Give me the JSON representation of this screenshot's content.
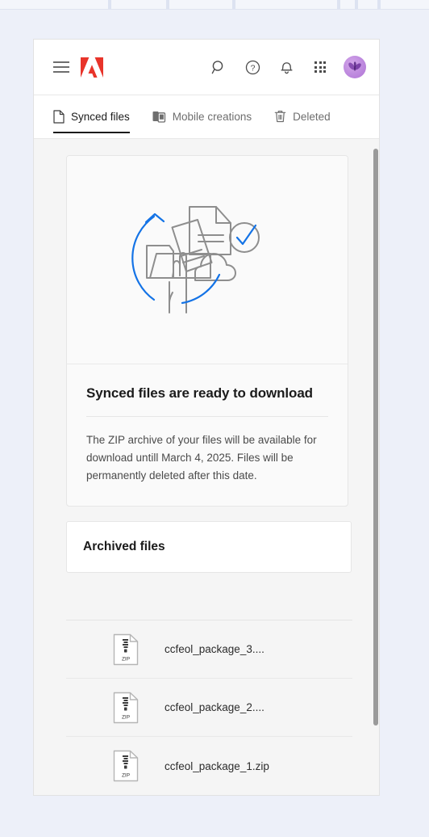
{
  "window": {
    "title": "Adobe Creative Cloud Files"
  },
  "header": {
    "menu_label": "Menu",
    "logo_label": "Adobe",
    "logo_color": "#E8342A",
    "icons": [
      {
        "name": "search-icon",
        "label": "Search"
      },
      {
        "name": "help-icon",
        "label": "Help"
      },
      {
        "name": "notifications-icon",
        "label": "Notifications"
      },
      {
        "name": "app-grid-icon",
        "label": "Apps"
      }
    ],
    "avatar_label": "Account"
  },
  "tabs": [
    {
      "id": "synced-files",
      "label": "Synced files",
      "icon": "document-icon",
      "active": true
    },
    {
      "id": "mobile-creations",
      "label": "Mobile creations",
      "icon": "mobile-device-icon",
      "active": false
    },
    {
      "id": "deleted",
      "label": "Deleted",
      "icon": "trash-icon",
      "active": false
    }
  ],
  "hero": {
    "illustration_name": "sync-to-cloud-illustration",
    "title": "Synced files are ready to download",
    "description": "The ZIP archive of your files will be available for download untill March 4, 2025. Files will be permanently deleted after this date."
  },
  "archived": {
    "title": "Archived files"
  },
  "files": [
    {
      "name": "ccfeol_package_3....",
      "type": "ZIP"
    },
    {
      "name": "ccfeol_package_2....",
      "type": "ZIP"
    },
    {
      "name": "ccfeol_package_1.zip",
      "type": "ZIP"
    }
  ],
  "colors": {
    "page_background": "#EDF0F9",
    "content_background": "#F5F5F5",
    "accent_blue": "#1473E6",
    "text_primary": "#1B1B1B",
    "text_secondary": "#6E6E6E",
    "illustration_gray": "#8E8E8E"
  }
}
